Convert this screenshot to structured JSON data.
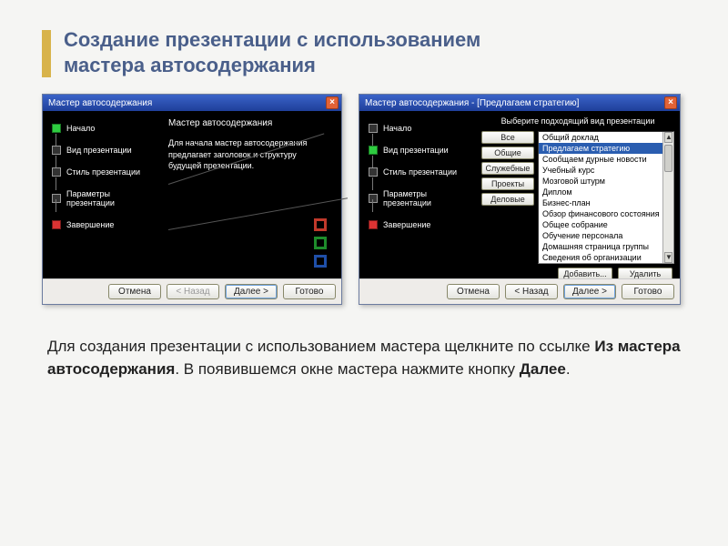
{
  "slide": {
    "title_line1": "Создание презентации с использованием",
    "title_line2": "мастера автосодержания",
    "body_prefix": "Для создания презентации с использованием мастера щелкните по ссылке ",
    "body_bold": "Из мастера автосодержания",
    "body_mid": ". В появившемся окне мастера нажмите кнопку ",
    "body_bold2": "Далее",
    "body_suffix": "."
  },
  "wizard_left": {
    "title": "Мастер автосодержания",
    "close": "×",
    "steps": [
      "Начало",
      "Вид презентации",
      "Стиль презентации",
      "Параметры презентации",
      "Завершение"
    ],
    "panel_heading": "Мастер автосодержания",
    "panel_desc": "Для начала мастер автосодержания предлагает заголовок и структуру будущей презентации.",
    "deco_colors": [
      "#c0392b",
      "#1e8c2b",
      "#1f4fa8"
    ],
    "nav": {
      "cancel": "Отмена",
      "back": "< Назад",
      "next": "Далее >",
      "finish": "Готово"
    }
  },
  "wizard_right": {
    "title": "Мастер автосодержания - [Предлагаем стратегию]",
    "close": "×",
    "steps": [
      "Начало",
      "Вид презентации",
      "Стиль презентации",
      "Параметры презентации",
      "Завершение"
    ],
    "prompt": "Выберите подходящий вид презентации",
    "categories": [
      "Все",
      "Общие",
      "Служебные",
      "Проекты",
      "Деловые"
    ],
    "list": [
      "Общий доклад",
      "Предлагаем стратегию",
      "Сообщаем дурные новости",
      "Учебный курс",
      "Мозговой штурм",
      "Диплом",
      "Бизнес-план",
      "Обзор финансового состояния",
      "Общее собрание",
      "Обучение персонала",
      "Домашняя страница группы",
      "Сведения об организации"
    ],
    "selected_index": 1,
    "add": "Добавить...",
    "remove": "Удалить",
    "nav": {
      "cancel": "Отмена",
      "back": "< Назад",
      "next": "Далее >",
      "finish": "Готово"
    }
  }
}
